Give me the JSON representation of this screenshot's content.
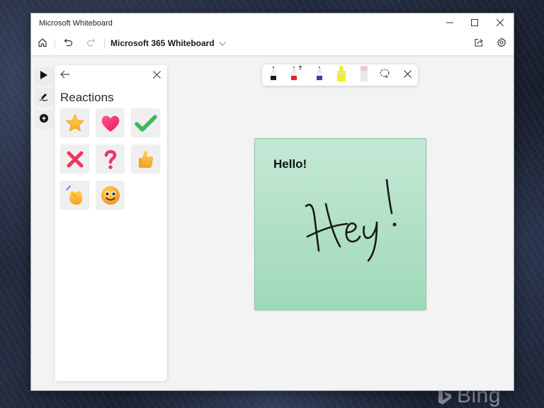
{
  "window": {
    "title": "Microsoft Whiteboard",
    "caption_buttons": [
      {
        "name": "minimize",
        "icon": "minimize-icon"
      },
      {
        "name": "maximize",
        "icon": "maximize-icon"
      },
      {
        "name": "close",
        "icon": "close-icon"
      }
    ]
  },
  "toolbar": {
    "home_icon": "home-icon",
    "undo_icon": "undo-icon",
    "redo_icon": "redo-icon",
    "board_title": "Microsoft 365 Whiteboard",
    "board_title_chevron": "chevron-down-icon",
    "share_icon": "share-icon",
    "settings_icon": "gear-icon"
  },
  "tool_rail": {
    "items": [
      {
        "name": "select",
        "icon": "pointer-icon",
        "active": true
      },
      {
        "name": "ink",
        "icon": "pen-icon",
        "active": false
      },
      {
        "name": "create",
        "icon": "plus-circle-icon",
        "active": false
      }
    ]
  },
  "reactions_panel": {
    "title": "Reactions",
    "back_icon": "arrow-left-icon",
    "close_icon": "close-icon",
    "reactions": [
      {
        "name": "star",
        "icon": "star-icon"
      },
      {
        "name": "heart",
        "icon": "heart-icon"
      },
      {
        "name": "check",
        "icon": "checkmark-icon"
      },
      {
        "name": "cross",
        "icon": "cross-mark-icon"
      },
      {
        "name": "question",
        "icon": "question-mark-icon"
      },
      {
        "name": "thumbs-up",
        "icon": "thumbs-up-icon"
      },
      {
        "name": "clap",
        "icon": "clapping-hands-icon"
      },
      {
        "name": "smile",
        "icon": "smiling-face-icon"
      }
    ]
  },
  "pen_toolbar": {
    "tools": [
      {
        "name": "black-pen",
        "color": "#1a1a1a"
      },
      {
        "name": "red-pen",
        "color": "#e0202a",
        "indicator": "arrow-up-icon"
      },
      {
        "name": "blue-pen",
        "color": "#2f4a8a"
      },
      {
        "name": "yellow-highlighter",
        "color": "#f2ea2a"
      },
      {
        "name": "eraser",
        "color": "#f4c6cc"
      }
    ],
    "lasso_icon": "lasso-select-icon",
    "close_icon": "close-icon"
  },
  "canvas": {
    "sticky_note": {
      "color": "#b3e1c7",
      "text": "Hello!",
      "ink_text": "Hey!"
    }
  },
  "desktop": {
    "watermark": "Bing"
  }
}
